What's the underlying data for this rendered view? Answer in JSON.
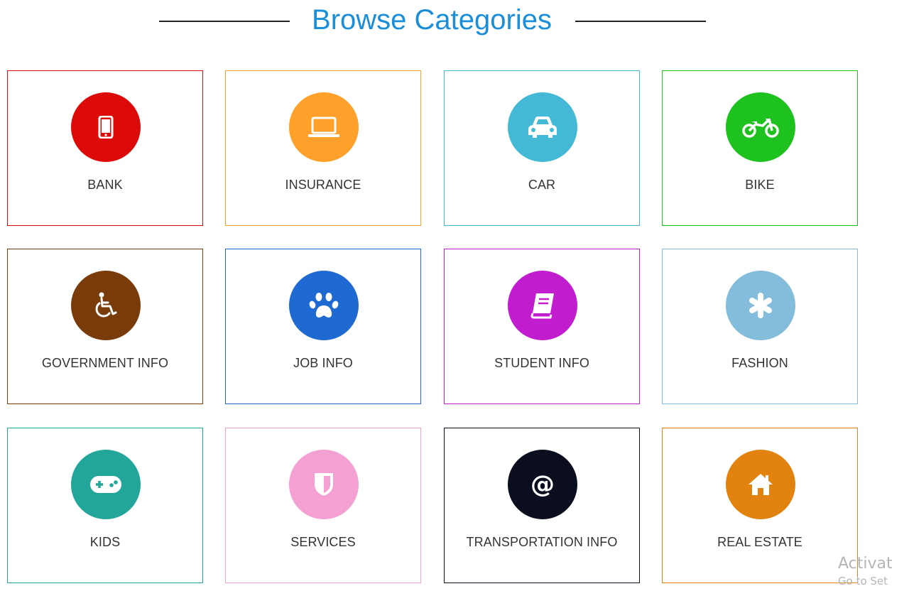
{
  "header": {
    "title": "Browse Categories"
  },
  "categories": [
    {
      "label": "BANK",
      "icon": "mobile-phone-icon",
      "color": "#dd0a0a"
    },
    {
      "label": "INSURANCE",
      "icon": "laptop-icon",
      "color": "#ffa02b"
    },
    {
      "label": "CAR",
      "icon": "car-icon",
      "color": "#43b9d6"
    },
    {
      "label": "BIKE",
      "icon": "motorcycle-icon",
      "color": "#1ec21e"
    },
    {
      "label": "GOVERNMENT INFO",
      "icon": "wheelchair-icon",
      "color": "#7a3b0b"
    },
    {
      "label": "JOB INFO",
      "icon": "paw-icon",
      "color": "#1e69d2"
    },
    {
      "label": "STUDENT INFO",
      "icon": "book-icon",
      "color": "#c21ccf"
    },
    {
      "label": "FASHION",
      "icon": "asterisk-icon",
      "color": "#84bcdb"
    },
    {
      "label": "KIDS",
      "icon": "gamepad-icon",
      "color": "#22a69a"
    },
    {
      "label": "SERVICES",
      "icon": "shield-icon",
      "color": "#f4a0d3"
    },
    {
      "label": "TRANSPORTATION INFO",
      "icon": "at-sign-icon",
      "color": "#0b0e1f"
    },
    {
      "label": "REAL ESTATE",
      "icon": "home-icon",
      "color": "#e2820f"
    }
  ],
  "watermark": {
    "line1": "Activat",
    "line2": "Go to Set"
  }
}
